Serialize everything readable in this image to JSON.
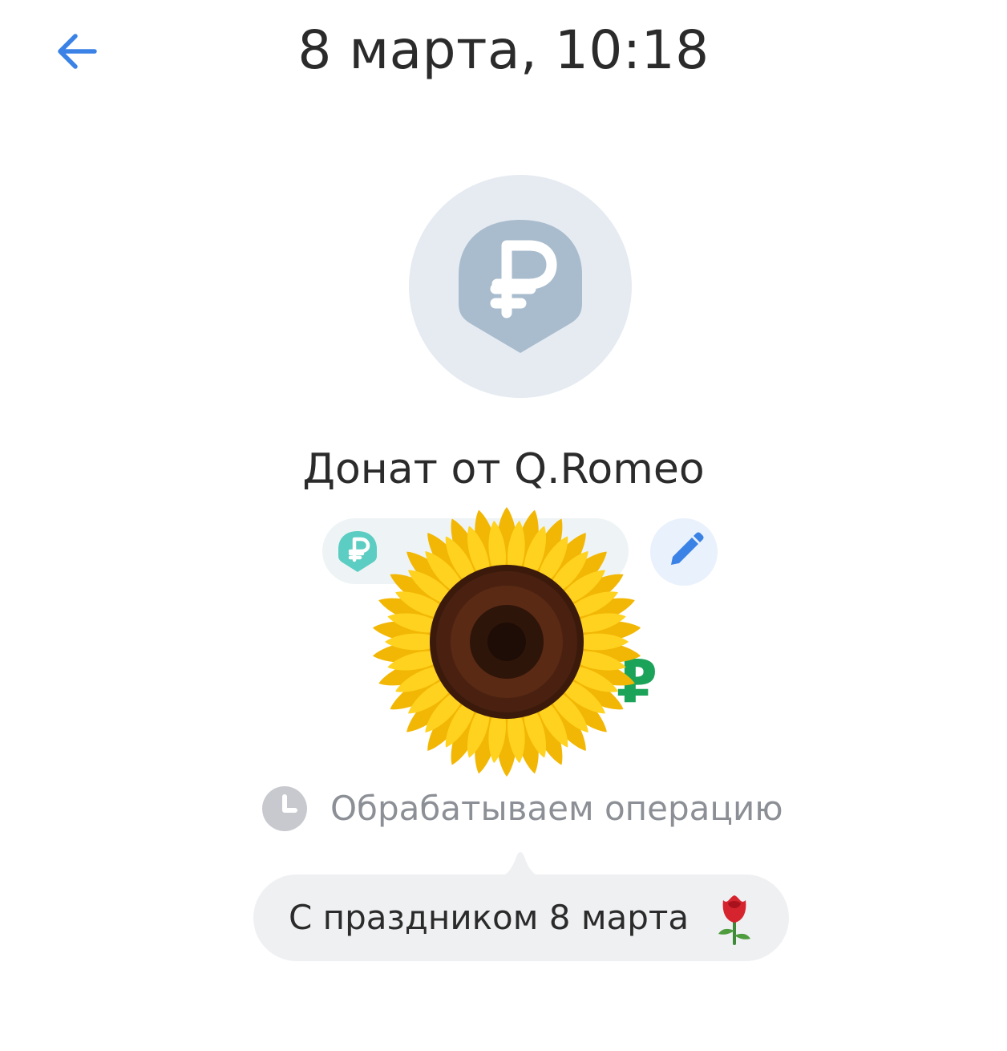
{
  "header": {
    "back_icon": "arrow-left-icon",
    "title": "8 марта, 10:18"
  },
  "operation": {
    "avatar_icon": "ruble-badge-icon",
    "title": "Донат от Q.Romeo",
    "category_icon": "ruble-badge-icon",
    "category_label": "",
    "edit_icon": "pencil-icon",
    "amount": "₽"
  },
  "status": {
    "icon": "clock-icon",
    "text": "Обрабатываем операцию"
  },
  "message": {
    "text": "С праздником 8 марта",
    "emoji_icon": "rose-icon"
  },
  "colors": {
    "accent": "#3b82e6",
    "avatar_bg": "#e6ebf2",
    "avatar_icon": "#a9bccd",
    "category_icon": "#5ccdc2",
    "amount": "#1ca35a",
    "status_text": "#8c9096",
    "bubble_bg": "#eff0f2"
  }
}
